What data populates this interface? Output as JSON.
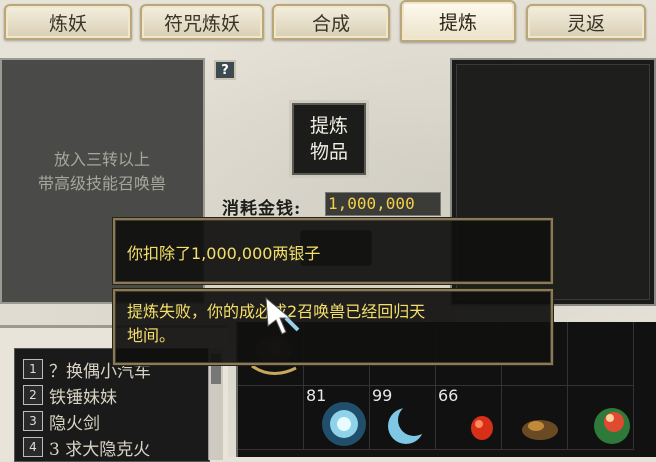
{
  "tabs": [
    {
      "label": "炼妖"
    },
    {
      "label": "符咒炼妖"
    },
    {
      "label": "合成"
    },
    {
      "label": "提炼"
    },
    {
      "label": "灵返"
    }
  ],
  "active_tab": "提炼",
  "help_label": "?",
  "left_panel": {
    "hint_line1": "放入三转以上",
    "hint_line2": "带高级技能召唤兽"
  },
  "item_slot": {
    "line1": "提炼",
    "line2": "物品"
  },
  "cost": {
    "label": "消耗金钱:",
    "value": "1,000,000"
  },
  "messages": {
    "deduct": "你扣除了1,000,000两银子",
    "fail_line1": "提炼失败，你的",
    "fail_line1_rest": "成必成2召唤兽已经回归天",
    "fail_line2": "地间。"
  },
  "pet_list": [
    {
      "num": "1",
      "name": "？换偶小汽车"
    },
    {
      "num": "2",
      "name": "铁锤妹妹"
    },
    {
      "num": "3",
      "name": "隐火剑"
    },
    {
      "num": "4",
      "name": "3 求大隐克火"
    }
  ],
  "inventory": [
    {
      "level": "",
      "icon": "dark-wing-item-icon"
    },
    {
      "level": "81",
      "icon": "blue-orb-icon"
    },
    {
      "level": "99",
      "icon": "crescent-moon-icon"
    },
    {
      "level": "66",
      "icon": "red-gem-icon"
    },
    {
      "level": "",
      "icon": "brown-lump-icon"
    },
    {
      "level": "",
      "icon": "green-red-orb-icon"
    }
  ],
  "colors": {
    "message_text": "#f4e068",
    "cost_value": "#f3d046",
    "panel_dark": "#1a1a1a"
  }
}
